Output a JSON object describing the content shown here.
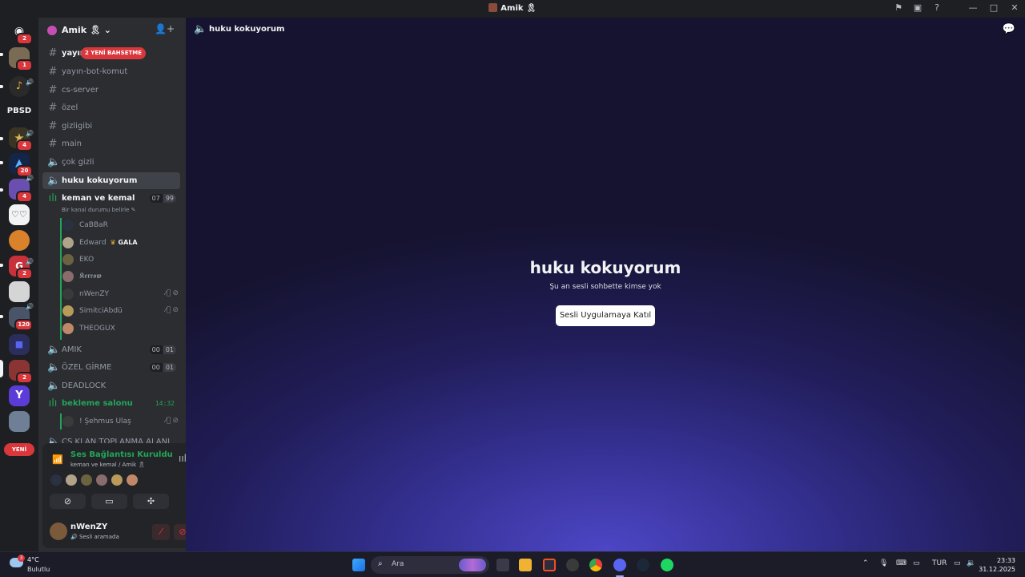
{
  "titlebar": {
    "title": "Amik 🎗"
  },
  "servers": {
    "pbsd_label": "PBSD",
    "new_label": "YENİ",
    "badges": [
      "2",
      "1",
      "4",
      "20",
      "4",
      "2",
      "120",
      "2"
    ]
  },
  "guild": {
    "name": "Amik 🎗"
  },
  "channels": [
    {
      "name": "yayın",
      "mention": "2 YENİ BAHSETME"
    },
    {
      "name": "yayın-bot-komut"
    },
    {
      "name": "cs-server"
    },
    {
      "name": "özel"
    },
    {
      "name": "gizligibi"
    },
    {
      "name": "main"
    },
    {
      "name": "çok gizli"
    },
    {
      "name": "huku kokuyorum"
    },
    {
      "name": "keman ve kemal",
      "count_a": "07",
      "count_b": "99",
      "status": "Bir kanal durumu belirle"
    },
    {
      "name": "AMIK",
      "count_a": "00",
      "count_b": "01"
    },
    {
      "name": "ÖZEL GİRME",
      "count_a": "00",
      "count_b": "01"
    },
    {
      "name": "DEADLOCK"
    },
    {
      "name": "bekleme salonu",
      "timer": "14:32"
    },
    {
      "name": "CS KLAN TOPLANMA ALANI"
    }
  ],
  "voice_users": [
    {
      "name": "CaBBaR"
    },
    {
      "name": "Edward",
      "tag": "GALA"
    },
    {
      "name": "EKO"
    },
    {
      "name": "𝕶𝖊𝖗𝖗𝖔𝖜"
    },
    {
      "name": "nWenZY"
    },
    {
      "name": "SimitciAbdü"
    },
    {
      "name": "THEOGUX"
    },
    {
      "name": "! Şehmus Ulaş"
    }
  ],
  "voice_panel": {
    "title": "Ses Bağlantısı Kuruldu",
    "subtitle": "keman ve kemal / Amik 🎗"
  },
  "user": {
    "name": "nWenZY",
    "status": "Sesli aramada"
  },
  "main": {
    "header_title": "huku kokuyorum",
    "title": "huku kokuyorum",
    "subtitle": "Şu an sesli sohbette kimse yok",
    "join_button": "Sesli Uygulamaya Katıl"
  },
  "taskbar": {
    "temp": "4°C",
    "weather": "Bulutlu",
    "weather_badge": "3",
    "search_placeholder": "Ara",
    "lang": "TUR",
    "time": "23:33",
    "date": "31.12.2025"
  },
  "colors": {
    "accent_green": "#23a559",
    "danger_red": "#da373c",
    "sidebar_bg": "#2b2d31",
    "server_bg": "#1e1f22"
  }
}
